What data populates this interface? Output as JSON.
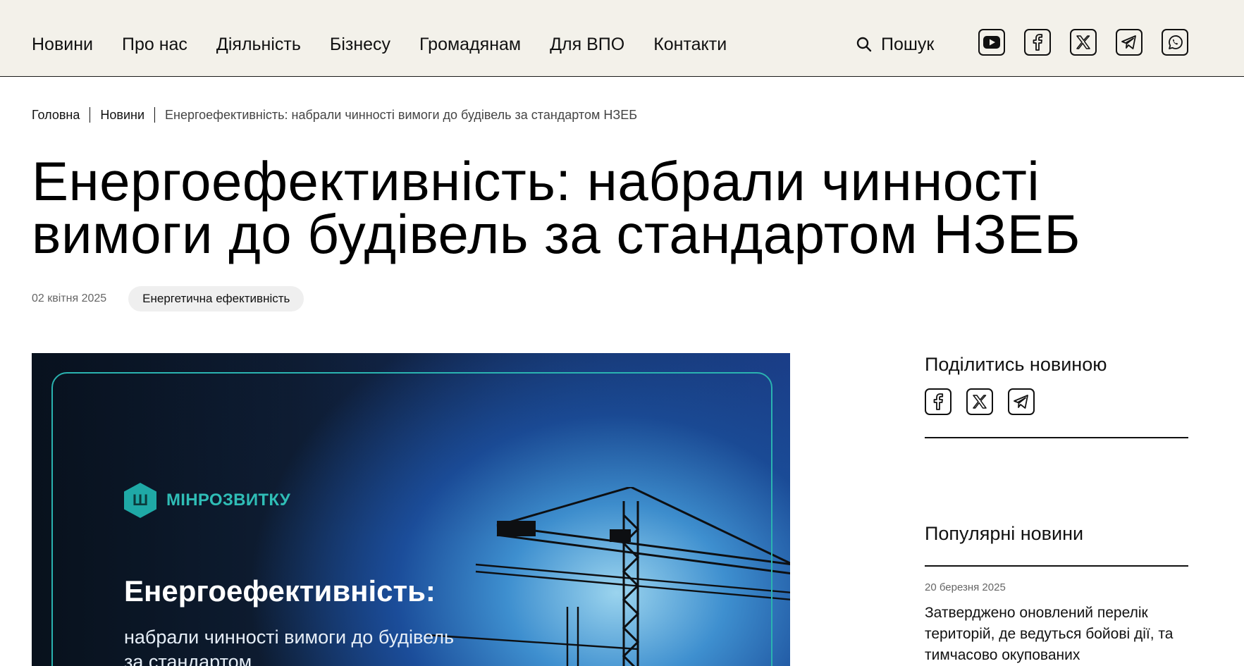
{
  "header": {
    "nav": [
      "Новини",
      "Про нас",
      "Діяльність",
      "Бізнесу",
      "Громадянам",
      "Для ВПО",
      "Контакти"
    ],
    "search_label": "Пошук",
    "socials": [
      "youtube-icon",
      "facebook-icon",
      "x-icon",
      "telegram-icon",
      "whatsapp-icon"
    ]
  },
  "breadcrumb": {
    "home": "Головна",
    "news": "Новини",
    "current": "Енергоефективність: набрали чинності вимоги до будівель за стандартом НЗЕБ"
  },
  "article": {
    "title": "Енергоефективність: набрали чинності вимоги до будівель за стандартом НЗЕБ",
    "date": "02 квітня 2025",
    "tag": "Енергетична ефективність"
  },
  "hero": {
    "logo_text": "МІНРОЗВИТКУ",
    "title": "Енергоефективність:",
    "subtitle": "набрали чинності вимоги до будівель за стандартом"
  },
  "sidebar": {
    "share_title": "Поділитись новиною",
    "share_socials": [
      "facebook-icon",
      "x-icon",
      "telegram-icon"
    ],
    "popular_title": "Популярні новини",
    "popular_items": [
      {
        "date": "20 березня 2025",
        "title": "Затверджено оновлений перелік територій, де ведуться бойові дії, та тимчасово окупованих"
      }
    ]
  },
  "colors": {
    "header_bg": "#f3f1ea",
    "accent_teal": "#1fa9a6",
    "tag_bg": "#efefef"
  }
}
